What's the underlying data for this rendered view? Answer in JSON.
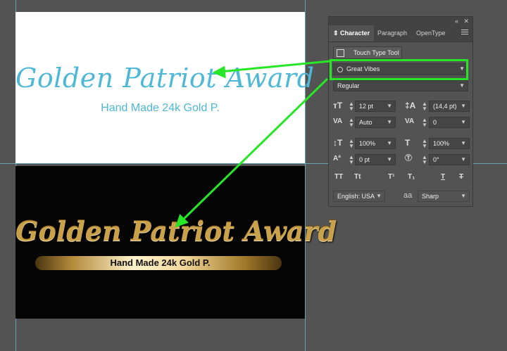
{
  "artboards": {
    "white": {
      "title": "Golden Patriot Award",
      "subtitle": "Hand Made 24k Gold P."
    },
    "black": {
      "title": "Golden Patriot Award",
      "subtitle": "Hand Made 24k Gold P."
    }
  },
  "panel": {
    "topbar": {
      "collapse": "«",
      "close": "✕"
    },
    "tabs": {
      "character": "Character",
      "paragraph": "Paragraph",
      "opentype": "OpenType"
    },
    "touch_type_tool": "Touch Type Tool",
    "font_family": "Great Vibes",
    "font_style": "Regular",
    "font_size": "12 pt",
    "leading": "(14,4 pt)",
    "kerning": "Auto",
    "tracking": "0",
    "vertical_scale": "100%",
    "horizontal_scale": "100%",
    "baseline_shift": "0 pt",
    "rotation": "0°",
    "language": "English: USA",
    "antialias": "Sharp",
    "antialias_icon": "aa",
    "format_buttons": {
      "all_caps": "TT",
      "small_caps": "Tt",
      "superscript": "T¹",
      "subscript": "T₁",
      "underline": "T",
      "strikethrough": "T"
    }
  },
  "colors": {
    "canvas": "#535353",
    "script_blue": "#4fb8d6",
    "gold": "#c9a14a",
    "annotation_green": "#27e627"
  }
}
